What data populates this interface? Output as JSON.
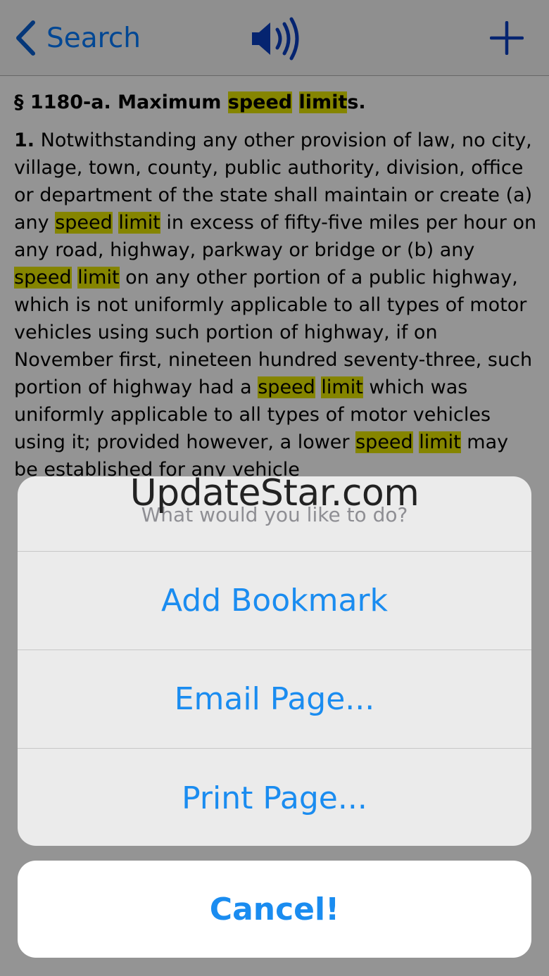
{
  "navbar": {
    "back_label": "Search",
    "back_icon": "chevron-left-icon",
    "speaker_icon": "speaker-icon",
    "add_icon": "plus-icon"
  },
  "content": {
    "section_title": {
      "pre": "§ 1180-a. Maximum ",
      "hl1": "speed",
      "mid": " ",
      "hl2": "limit",
      "post": "s."
    },
    "para1": [
      {
        "t": "1.",
        "k": "b"
      },
      {
        "t": " Notwithstanding any other provision of law, no city, village, town, county, public authority, division, office or department of the state shall maintain or create (a) any "
      },
      {
        "t": "speed",
        "k": "hl"
      },
      {
        "t": " "
      },
      {
        "t": "limit",
        "k": "hl"
      },
      {
        "t": " in excess of fifty-five miles per hour on any road, highway, parkway or bridge or (b) any "
      },
      {
        "t": "speed",
        "k": "hl"
      },
      {
        "t": " "
      },
      {
        "t": "limit",
        "k": "hl"
      },
      {
        "t": " on any other portion of a public highway, which is not uniformly applicable to all types of motor vehicles using such portion of highway, if on November first, nineteen hundred seventy-three, such portion of highway had a "
      },
      {
        "t": "speed",
        "k": "hl"
      },
      {
        "t": " "
      },
      {
        "t": "limit",
        "k": "hl"
      },
      {
        "t": " which was uniformly applicable to all types of motor vehicles using it; provided however, a lower "
      },
      {
        "t": "speed",
        "k": "hl"
      },
      {
        "t": " "
      },
      {
        "t": "limit",
        "k": "hl"
      },
      {
        "t": " may be established for any vehicle"
      }
    ]
  },
  "sheet": {
    "watermark": "UpdateStar.com",
    "prompt": "What would you like to do?",
    "actions": [
      "Add Bookmark",
      "Email Page...",
      "Print Page..."
    ],
    "cancel_label": "Cancel!"
  },
  "colors": {
    "accent": "#1a8cf0",
    "highlight": "#e6e600",
    "nav_icon": "#0a3fc2"
  }
}
